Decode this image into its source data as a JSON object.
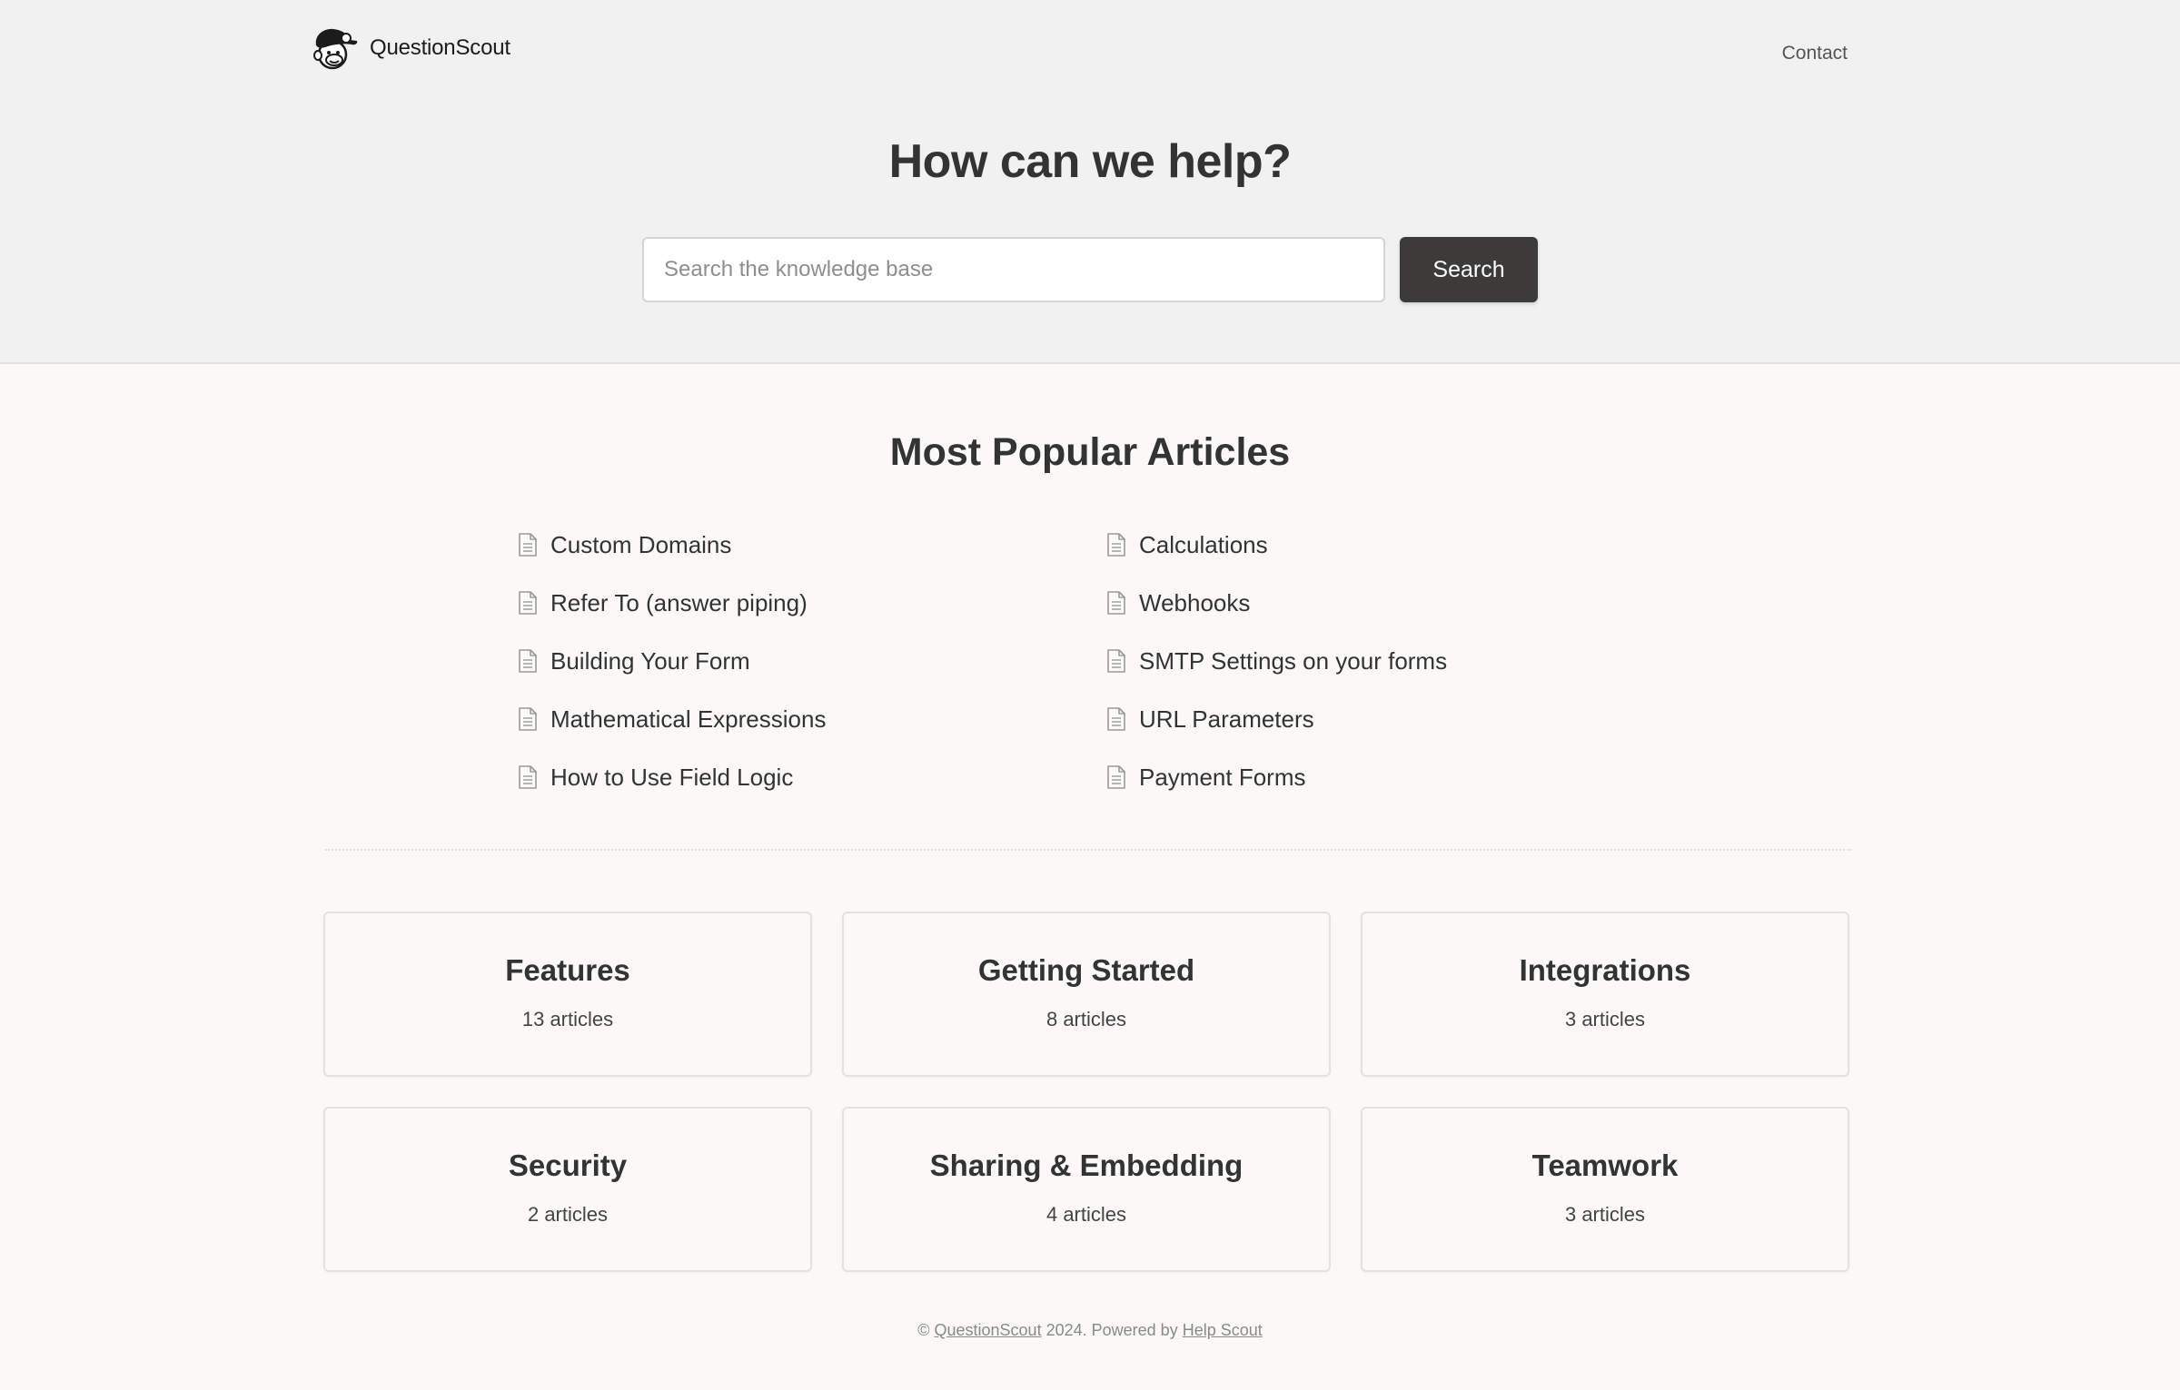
{
  "header": {
    "brand_name": "QuestionScout",
    "logo_icon": "monkey-mascot-icon",
    "nav_contact": "Contact"
  },
  "hero": {
    "title": "How can we help?",
    "search_placeholder": "Search the knowledge base",
    "search_value": "",
    "search_button": "Search"
  },
  "popular": {
    "title": "Most Popular Articles",
    "article_icon": "document-icon",
    "articles": [
      "Custom Domains",
      "Calculations",
      "Refer To (answer piping)",
      "Webhooks",
      "Building Your Form",
      "SMTP Settings on your forms",
      "Mathematical Expressions",
      "URL Parameters",
      "How to Use Field Logic",
      "Payment Forms"
    ]
  },
  "categories": [
    {
      "name": "Features",
      "count": "13 articles"
    },
    {
      "name": "Getting Started",
      "count": "8 articles"
    },
    {
      "name": "Integrations",
      "count": "3 articles"
    },
    {
      "name": "Security",
      "count": "2 articles"
    },
    {
      "name": "Sharing & Embedding",
      "count": "4 articles"
    },
    {
      "name": "Teamwork",
      "count": "3 articles"
    }
  ],
  "footer": {
    "copyright": "©",
    "brand_link": "QuestionScout",
    "year_text": "2024. Powered by",
    "powered_link": "Help Scout"
  },
  "colors": {
    "hero_bg": "#f1f1f1",
    "page_bg": "#faf9f7",
    "button_bg": "#3c3b39",
    "text": "#333333"
  }
}
